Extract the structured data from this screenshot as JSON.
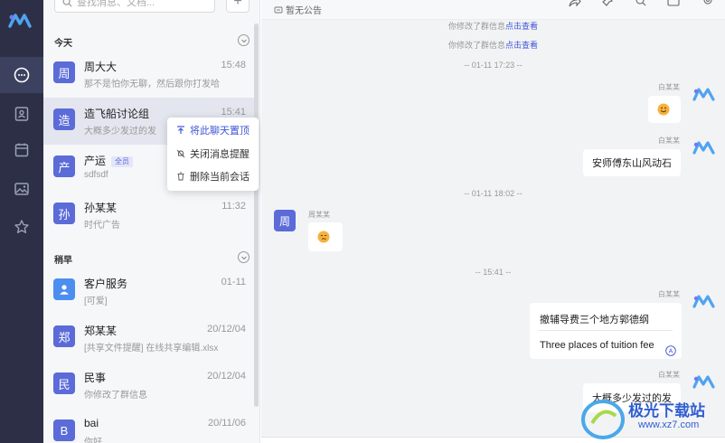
{
  "search": {
    "placeholder": "查找消息、文档..."
  },
  "add_label": "+",
  "groups": [
    {
      "label": "今天"
    },
    {
      "label": "稍早"
    }
  ],
  "conversations": [
    {
      "avatar": "周",
      "name": "周大大",
      "time": "15:48",
      "preview": "那不是怕你无聊，然后跟你打发哈..."
    },
    {
      "avatar": "造",
      "name": "造飞船讨论组",
      "time": "15:41",
      "preview": "大概多少发过的发"
    },
    {
      "avatar": "产",
      "name": "产运",
      "badge": "全员",
      "time": "",
      "preview": "sdfsdf"
    },
    {
      "avatar": "孙",
      "name": "孙某某",
      "time": "11:32",
      "preview": "时代广告"
    },
    {
      "avatar": "",
      "name": "客户服务",
      "time": "01-11",
      "preview": "[可爱]"
    },
    {
      "avatar": "郑",
      "name": "郑某某",
      "time": "20/12/04",
      "preview": "[共享文件提醒] 在线共享编辑.xlsx"
    },
    {
      "avatar": "民",
      "name": "民事",
      "time": "20/12/04",
      "preview": "你修改了群信息"
    },
    {
      "avatar": "B",
      "name": "bai",
      "time": "20/11/06",
      "preview": "你好"
    }
  ],
  "context_menu": {
    "items": [
      {
        "label": "将此聊天置顶"
      },
      {
        "label": "关闭消息提醒"
      },
      {
        "label": "删除当前会话"
      }
    ]
  },
  "chat": {
    "notice": "暂无公告",
    "system_lines": [
      {
        "text": "你修改了群信息",
        "link": "点击查看"
      },
      {
        "text": "你修改了群信息",
        "link": "点击查看"
      }
    ],
    "time_dividers": [
      "-- 01-11 17:23 --",
      "-- 01-11 18:02 --",
      "-- 15:41 --"
    ],
    "sender_self": "白某某",
    "sender_other": "周某某",
    "msg_stone": "安师傅东山风动石",
    "msg_trans_src": "撤辅导费三个地方郭德纲",
    "msg_trans_dst": "Three places of tuition fee",
    "msg_last": "大概多少发过的发",
    "trans_icon": "A"
  },
  "watermark": {
    "name": "极光下载站",
    "url": "www.xz7.com"
  },
  "colors": {
    "accent": "#3f56d6",
    "rail": "#2c2f45",
    "avatar": "#5b6bd8"
  }
}
